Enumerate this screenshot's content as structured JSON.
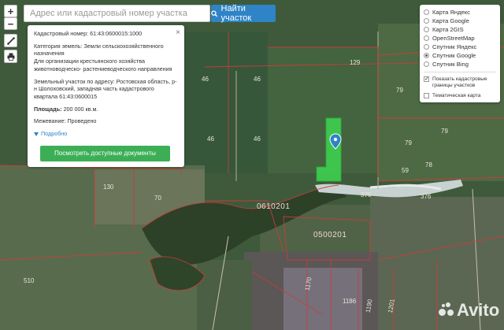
{
  "search": {
    "placeholder": "Адрес или кадастровый номер участка",
    "button_label": "Найти участок"
  },
  "controls": {
    "zoom_in": "+",
    "zoom_out": "−"
  },
  "info": {
    "cadastral_label": "Кадастровый номер:",
    "cadastral_value": "61:43:0600015:1000",
    "category_label": "Категория земель:",
    "category_value": "Земли сельскохозяйственного назначения",
    "purpose_value": "Для организации крестьянского хозяйства животноводческо- растениеводческого направления",
    "address_label": "Земельный участок по адресу:",
    "address_value": "Ростовская область, р-н Шолоховский, западная часть кадастрового квартала 61:43:0600015",
    "area_label": "Площадь:",
    "area_value": "200 000 кв.м.",
    "survey_label": "Межевание:",
    "survey_value": "Проведено",
    "more_label": "Подробно",
    "docs_button": "Посмотреть доступные документы",
    "close": "×"
  },
  "layers": {
    "options": [
      {
        "label": "Карта Яндекс",
        "selected": false
      },
      {
        "label": "Карта Google",
        "selected": false
      },
      {
        "label": "Карта 2GIS",
        "selected": false
      },
      {
        "label": "OpenStreetMap",
        "selected": false
      },
      {
        "label": "Спутник Яндекс",
        "selected": false
      },
      {
        "label": "Спутник Google",
        "selected": true
      },
      {
        "label": "Спутник Bing",
        "selected": false
      }
    ],
    "cadastral_borders": {
      "label": "Показать кадастровые границы участков",
      "checked": true
    },
    "thematic": {
      "label": "Тематическая карта",
      "checked": false
    }
  },
  "map": {
    "parcels": [
      "46",
      "46",
      "46",
      "46",
      "129",
      "79",
      "79",
      "79",
      "59",
      "78",
      "130",
      "70",
      "376",
      "376",
      "510",
      "1170",
      "1186",
      "1190",
      "1201"
    ],
    "quarters": [
      "0610201",
      "0500201"
    ]
  },
  "watermark": "Avito",
  "colors": {
    "accent_blue": "#2e84c6",
    "button_green": "#3caf56",
    "parcel_highlight": "#3ecf4f",
    "border_red": "#d23a3a"
  }
}
